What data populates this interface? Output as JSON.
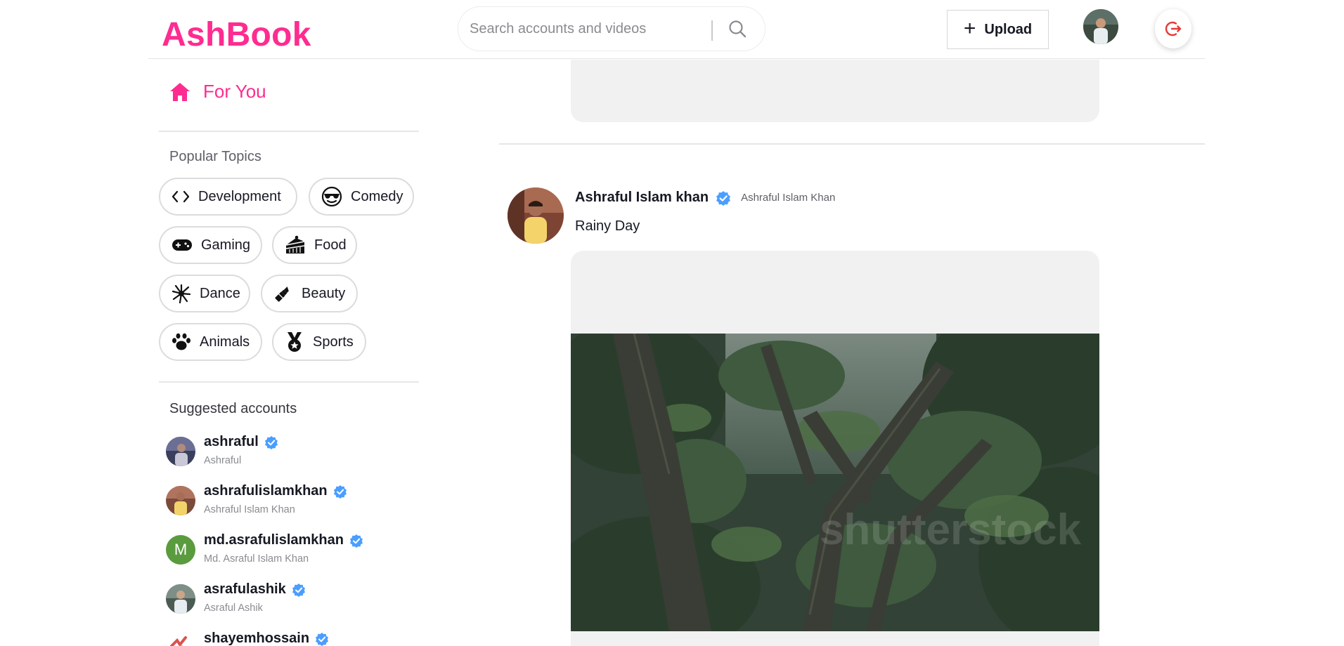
{
  "app": {
    "logo": "AshBook"
  },
  "header": {
    "search_placeholder": "Search accounts and videos",
    "upload_label": "Upload"
  },
  "sidebar": {
    "for_you_label": "For You",
    "popular_title": "Popular Topics",
    "topics": [
      {
        "label": "Development",
        "icon": "code-icon"
      },
      {
        "label": "Comedy",
        "icon": "sunglasses-face-icon"
      },
      {
        "label": "Gaming",
        "icon": "gamepad-icon"
      },
      {
        "label": "Food",
        "icon": "cake-icon"
      },
      {
        "label": "Dance",
        "icon": "dance-burst-icon"
      },
      {
        "label": "Beauty",
        "icon": "lipstick-icon"
      },
      {
        "label": "Animals",
        "icon": "paw-icon"
      },
      {
        "label": "Sports",
        "icon": "medal-icon"
      }
    ],
    "suggested_title": "Suggested accounts",
    "accounts": [
      {
        "username": "ashraful",
        "name": "Ashraful",
        "avatar": "photo"
      },
      {
        "username": "ashrafulislamkhan",
        "name": "Ashraful Islam Khan",
        "avatar": "photo"
      },
      {
        "username": "md.asrafulislamkhan",
        "name": "Md. Asraful Islam Khan",
        "avatar": "letter",
        "letter": "M"
      },
      {
        "username": "asrafulashik",
        "name": "Asraful Ashik",
        "avatar": "photo"
      },
      {
        "username": "shayemhossain",
        "name": "",
        "avatar": "photo"
      }
    ]
  },
  "post": {
    "username": "Ashraful Islam khan",
    "name": "Ashraful Islam Khan",
    "caption": "Rainy Day",
    "video_watermark": "shutterstock"
  },
  "colors": {
    "brand": "#fe2c90",
    "verified": "#20d5ec",
    "verified_badge": "#4a9eff",
    "logout_icon": "#e53935",
    "avatar_letter_bg": "#5a9b3e"
  }
}
